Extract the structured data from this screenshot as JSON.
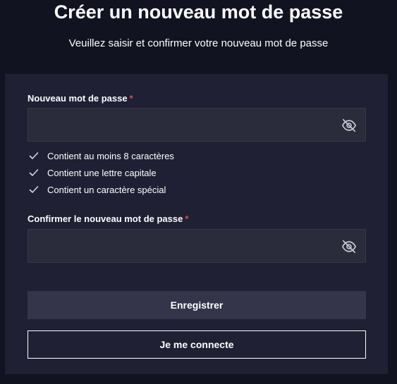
{
  "title": "Créer un nouveau mot de passe",
  "subtitle": "Veuillez saisir et confirmer votre nouveau mot de passe",
  "new_password": {
    "label": "Nouveau mot de passe",
    "required_marker": "*",
    "value": "",
    "icon": "eye-off-icon"
  },
  "rules": [
    {
      "text": "Contient au moins 8 caractères",
      "icon": "check-icon"
    },
    {
      "text": "Contient une lettre capitale",
      "icon": "check-icon"
    },
    {
      "text": "Contient un caractère spécial",
      "icon": "check-icon"
    }
  ],
  "confirm_password": {
    "label": "Confirmer le nouveau mot de passe",
    "required_marker": "*",
    "value": "",
    "icon": "eye-off-icon"
  },
  "buttons": {
    "save": "Enregistrer",
    "login": "Je me connecte"
  },
  "colors": {
    "background": "#121321",
    "card": "#1f2033",
    "input": "#2a2b3b",
    "primary_button": "#34354a",
    "required": "#e5484d"
  }
}
